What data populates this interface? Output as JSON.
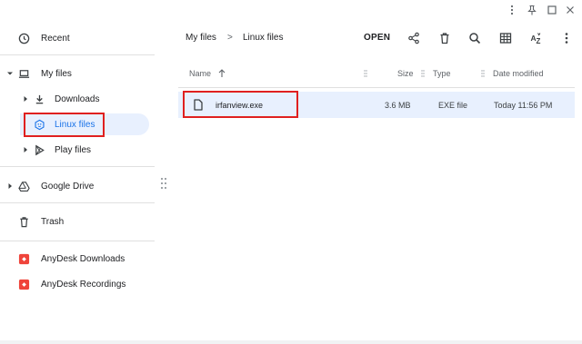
{
  "window": {
    "controls": [
      {
        "name": "more-options-icon"
      },
      {
        "name": "pin-icon"
      },
      {
        "name": "maximize-icon"
      },
      {
        "name": "close-icon"
      }
    ]
  },
  "sidebar": {
    "recent": "Recent",
    "my_files": "My files",
    "downloads": "Downloads",
    "linux_files": "Linux files",
    "play_files": "Play files",
    "google_drive": "Google Drive",
    "trash": "Trash",
    "anydesk_downloads": "AnyDesk Downloads",
    "anydesk_recordings": "AnyDesk Recordings"
  },
  "breadcrumb": {
    "root": "My files",
    "separator": ">",
    "current": "Linux files"
  },
  "toolbar": {
    "open_label": "OPEN",
    "icons": [
      "share-icon",
      "delete-icon",
      "search-icon",
      "grid-view-icon",
      "sort-az-icon",
      "more-icon"
    ]
  },
  "columns": {
    "name": "Name",
    "size": "Size",
    "type": "Type",
    "date": "Date modified"
  },
  "files": [
    {
      "name": "irfanview.exe",
      "size": "3.6 MB",
      "type": "EXE file",
      "date": "Today 11:56 PM",
      "selected": true
    }
  ],
  "colors": {
    "selected_bg": "#e8f0fe",
    "accent": "#1a73e8",
    "highlight_box": "#e0201f"
  }
}
